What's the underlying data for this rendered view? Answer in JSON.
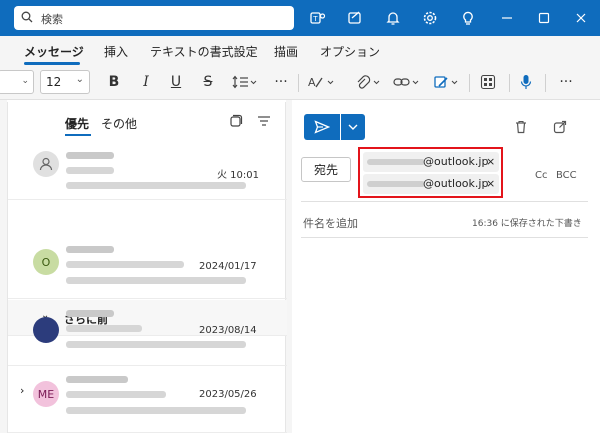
{
  "search": {
    "placeholder": "検索"
  },
  "ribbon": {
    "tabs": [
      {
        "label": "メッセージ",
        "active": true
      },
      {
        "label": "挿入"
      },
      {
        "label": "テキストの書式設定"
      },
      {
        "label": "描画"
      },
      {
        "label": "オプション"
      }
    ]
  },
  "toolbar": {
    "font_size": "12"
  },
  "mail_list": {
    "tabs": {
      "focused": "優先",
      "other": "その他"
    },
    "items": [
      {
        "date": "火 10:01"
      },
      {
        "avatar": "O",
        "date": "2024/01/17"
      },
      {
        "date": "2023/08/14"
      },
      {
        "avatar": "ME",
        "date": "2023/05/26"
      }
    ],
    "section_label": "さらに前"
  },
  "compose": {
    "to_label": "宛先",
    "recipients": [
      {
        "domain": "@outlook.jp",
        "remove": "×"
      },
      {
        "domain": "@outlook.jp",
        "remove": "×"
      }
    ],
    "cc": "Cc",
    "bcc": "BCC",
    "subject_placeholder": "件名を追加",
    "saved_status": "16:36 に保存された下書き"
  },
  "colors": {
    "accent": "#0f6cbd",
    "highlight": "#e3141b"
  }
}
